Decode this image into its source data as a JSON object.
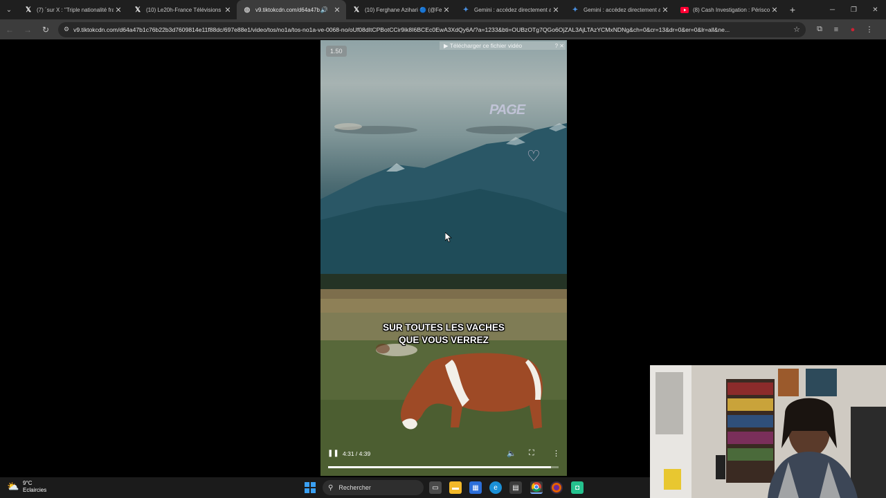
{
  "browser": {
    "tabs": [
      {
        "title": "(7) ´sur X : \"Triple nationalité fra",
        "icon": "x-logo-icon",
        "active": false
      },
      {
        "title": "(10) Le20h-France Télévisions s",
        "icon": "x-logo-icon",
        "active": false
      },
      {
        "title": "v9.tiktokcdn.com/d64a47b",
        "icon": "globe-icon",
        "active": true
      },
      {
        "title": "(10) Ferghane Azihari 🔵 (@Fe",
        "icon": "x-logo-icon",
        "active": false
      },
      {
        "title": "Gemini : accédez directement a",
        "icon": "gemini-icon",
        "active": false
      },
      {
        "title": "Gemini : accédez directement a",
        "icon": "gemini-icon",
        "active": false
      },
      {
        "title": "(8) Cash Investigation : Périscol",
        "icon": "youtube-icon",
        "active": false
      }
    ],
    "url": "v9.tiktokcdn.com/d64a47b1c76b22b3d7609814e11f88dc/697e88e1/video/tos/no1a/tos-no1a-ve-0068-no/oUf08dItCPBotCCir9ik8I6BCEc0EwA3XdQy6A/?a=1233&bti=OUBzOTg7QGo6OjZAL3AjLTAzYCMxNDNg&ch=0&cr=13&dr=0&er=0&lr=all&ne..."
  },
  "video": {
    "speed_badge": "1.50",
    "download_bar": "▶ Télécharger ce fichier vidéo",
    "download_extra": "? ✕",
    "watermark": "PAGE",
    "subtitle_line1": "SUR TOUTES LES VACHES",
    "subtitle_line2": "QUE VOUS VERREZ",
    "time": "4:31 / 4:39",
    "progress": 0.968
  },
  "taskbar": {
    "weather_temp": "9°C",
    "weather_desc": "Eclaircies",
    "search_placeholder": "Rechercher"
  },
  "colors": {
    "accent": "#3aa0f3",
    "youtube": "#ff0033",
    "gemini": "#4a90e2"
  }
}
